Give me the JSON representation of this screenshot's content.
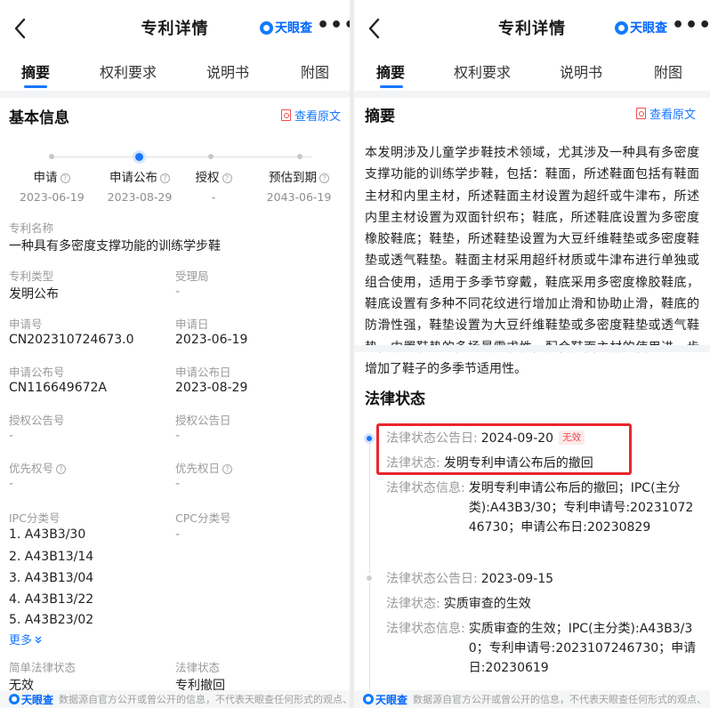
{
  "header": {
    "title": "专利详情",
    "brand": "天眼查",
    "more": "•••"
  },
  "tabs": [
    "摘要",
    "权利要求",
    "说明书",
    "附图"
  ],
  "left": {
    "section_title": "基本信息",
    "view_original": "查看原文",
    "timeline": [
      {
        "label": "申请",
        "date": "2023-06-19",
        "help": true
      },
      {
        "label": "申请公布",
        "date": "2023-08-29",
        "help": true,
        "current": true
      },
      {
        "label": "授权",
        "date": "-",
        "help": true
      },
      {
        "label": "预估到期",
        "date": "2043-06-19",
        "help": true
      }
    ],
    "patent_name_label": "专利名称",
    "patent_name": "一种具有多密度支撑功能的训练学步鞋",
    "fields": [
      {
        "label": "专利类型",
        "value": "发明公布"
      },
      {
        "label": "受理局",
        "value": "-"
      },
      {
        "label": "申请号",
        "value": "CN202310724673.0"
      },
      {
        "label": "申请日",
        "value": "2023-06-19"
      },
      {
        "label": "申请公布号",
        "value": "CN116649672A"
      },
      {
        "label": "申请公布日",
        "value": "2023-08-29"
      },
      {
        "label": "授权公告号",
        "value": "-"
      },
      {
        "label": "授权公告日",
        "value": "-"
      },
      {
        "label": "优先权号",
        "value": "-",
        "help": true
      },
      {
        "label": "优先权日",
        "value": "-",
        "help": true
      }
    ],
    "ipc_label": "IPC分类号",
    "ipc_items": [
      "1. A43B3/30",
      "2. A43B13/14",
      "3. A43B13/04",
      "4. A43B13/22",
      "5. A43B23/02"
    ],
    "cpc_label": "CPC分类号",
    "cpc_value": "-",
    "more_label": "更多",
    "simple_status_label": "简单法律状态",
    "simple_status_value": "无效",
    "legal_status_label": "法律状态",
    "legal_status_value": "专利撤回"
  },
  "right": {
    "section_title": "摘要",
    "view_original": "查看原文",
    "abstract": "本发明涉及儿童学步鞋技术领域，尤其涉及一种具有多密度支撑功能的训练学步鞋，包括：鞋面，所述鞋面包括有鞋面主材和内里主材，所述鞋面主材设置为超纤或牛津布，所述内里主材设置为双面针织布；鞋底，所述鞋底设置为多密度橡胶鞋底；鞋垫，所述鞋垫设置为大豆纤维鞋垫或多密度鞋垫或透气鞋垫。鞋面主材采用超纤材质或牛津布进行单独或组合使用，适用于多季节穿戴，鞋底采用多密度橡胶鞋底，鞋底设置有多种不同花纹进行增加止滑和协助止滑，鞋底的防滑性强，鞋垫设置为大豆纤维鞋垫或多密度鞋垫或透气鞋垫，内置鞋垫的多场景需求性，配合鞋面主材的使用进一步增加了鞋子的多季节适用性。",
    "legal_title": "法律状态",
    "entries": [
      {
        "date_label": "法律状态公告日:",
        "date": "2024-09-20",
        "badge": "无效",
        "status_label": "法律状态:",
        "status": "发明专利申请公布后的撤回",
        "info_label": "法律状态信息:",
        "info": "发明专利申请公布后的撤回；IPC(主分类):A43B3/30；专利申请号:2023107246730；申请公布日:20230829"
      },
      {
        "date_label": "法律状态公告日:",
        "date": "2023-09-15",
        "badge": "",
        "status_label": "法律状态:",
        "status": "实质审查的生效",
        "info_label": "法律状态信息:",
        "info": "实质审查的生效；IPC(主分类):A43B3/30；专利申请号:2023107246730；申请日:20230619"
      }
    ]
  },
  "footer": {
    "brand": "天眼查",
    "text": "数据源自官方公开或曾公开的信息，不代表天眼查任何形式的观点、"
  },
  "colors": {
    "accent": "#1677ff",
    "brand": "#0066ff",
    "highlight_box": "#e8262d",
    "invalid_badge": "#f04b4b"
  }
}
